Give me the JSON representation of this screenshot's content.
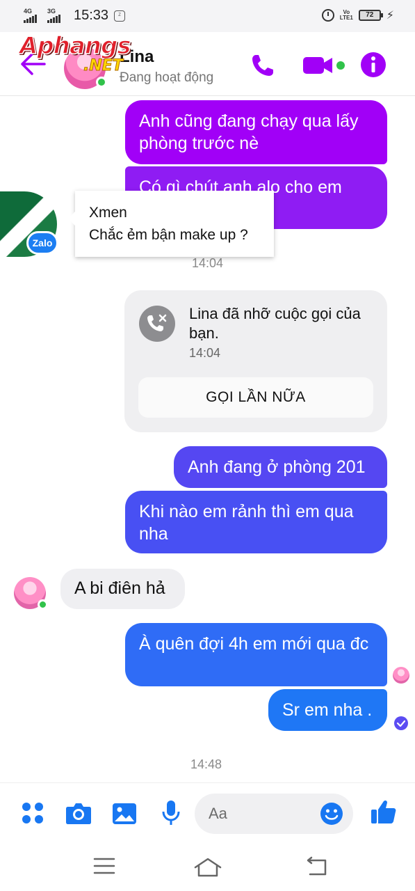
{
  "status_bar": {
    "network1": "4G",
    "network2": "3G",
    "time": "15:33",
    "volte": "VoLTE1",
    "battery": "72"
  },
  "header": {
    "name": "Lina",
    "status": "Đang hoạt động",
    "watermark": "Aphangs",
    "watermark_suffix": ".NET"
  },
  "messages": [
    {
      "text": "Anh cũng đang chạy qua lấy phòng trước nè"
    },
    {
      "text": "Có gì chút anh alo cho em xuống rồi đi đẹp"
    },
    {
      "text": "Anh đang ở phòng 201"
    },
    {
      "text": "Khi nào em rảnh thì em qua nha"
    },
    {
      "text": "A bi điên hả"
    },
    {
      "text": "À quên đợi 4h em mới qua đc"
    },
    {
      "text": "Sr em nha ."
    }
  ],
  "call_card": {
    "text": "Lina đã nhỡ cuộc gọi của bạn.",
    "time": "14:04",
    "button": "GỌI LẦN NỮA"
  },
  "timestamps": {
    "t1": "14:04",
    "t2": "14:48"
  },
  "notification": {
    "app_badge": "Zalo",
    "title": "Xmen",
    "message": "Chắc ẻm bận make up ?"
  },
  "composer": {
    "placeholder": "Aa"
  },
  "colors": {
    "accent": "#a100f7",
    "gradient_end": "#1f77f5",
    "online": "#31c24a"
  },
  "icons": {
    "header": [
      "back-arrow-icon",
      "phone-icon",
      "video-camera-icon",
      "info-icon"
    ],
    "composer": [
      "apps-icon",
      "camera-icon",
      "gallery-icon",
      "microphone-icon",
      "emoji-icon",
      "thumbs-up-icon"
    ],
    "nav": [
      "menu-icon",
      "home-icon",
      "back-icon"
    ]
  }
}
